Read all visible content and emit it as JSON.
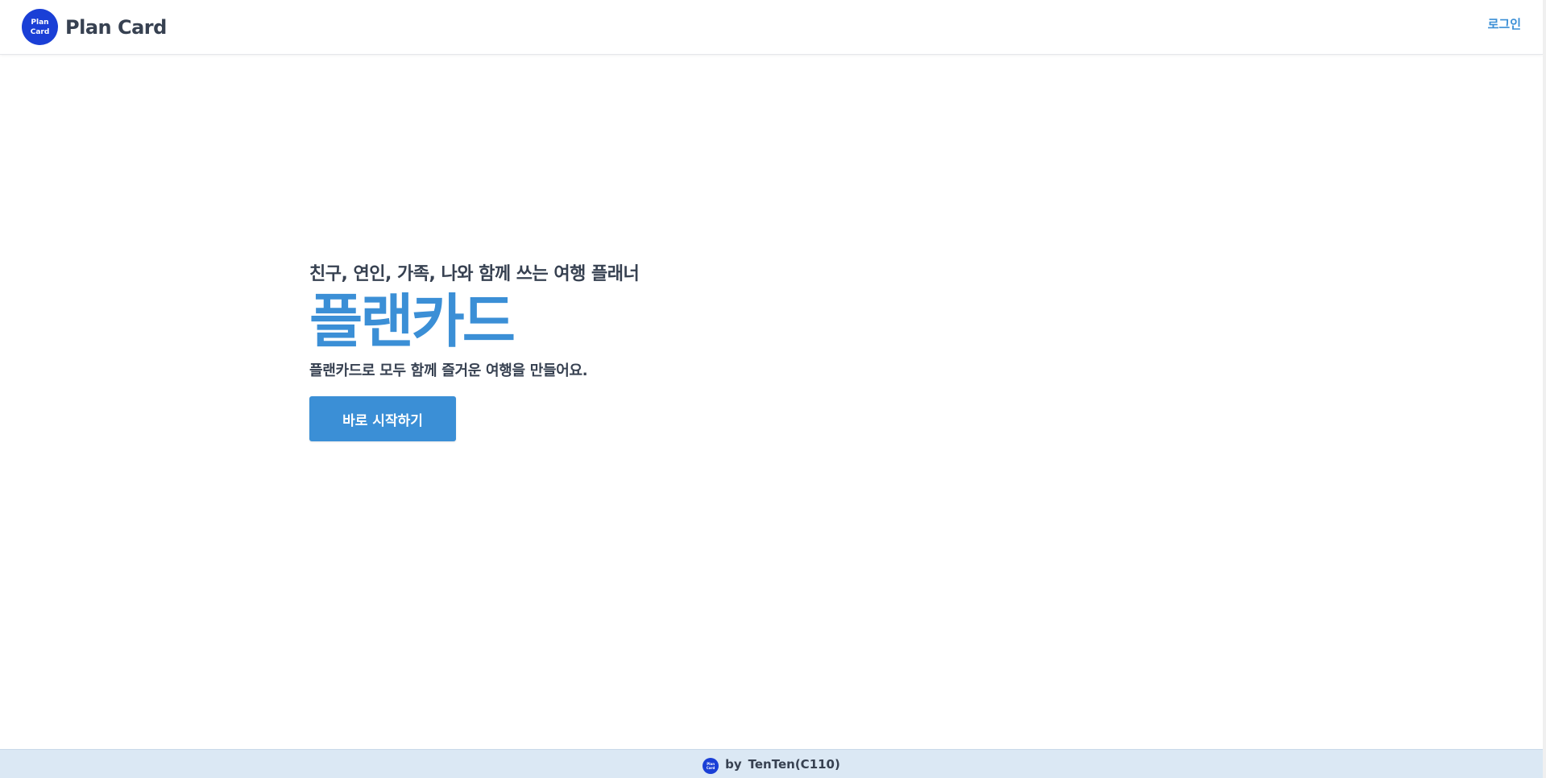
{
  "header": {
    "logo_line1": "Plan",
    "logo_line2": "Card",
    "brand_name": "Plan Card",
    "login_label": "로그인"
  },
  "hero": {
    "tagline": "친구, 연인, 가족, 나와 함께 쓰는 여행 플래너",
    "title": "플랜카드",
    "description": "플랜카드로 모두 함께 즐거운 여행을 만들어요.",
    "start_button_label": "바로 시작하기"
  },
  "footer": {
    "logo_line1": "Plan",
    "logo_line2": "Card",
    "by_label": "by",
    "team_name": "TenTen(C110)"
  },
  "colors": {
    "accent": "#3b8fd6",
    "logo_blue": "#1a3fd6",
    "text_dark": "#374151",
    "footer_bg": "#dbe8f4"
  }
}
